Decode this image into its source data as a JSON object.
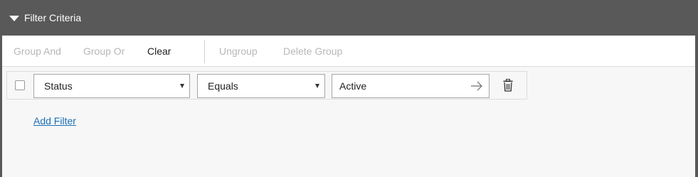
{
  "header": {
    "title": "Filter Criteria",
    "icon": "caret-down-icon"
  },
  "toolbar": {
    "group_and": "Group And",
    "group_or": "Group Or",
    "clear": "Clear",
    "ungroup": "Ungroup",
    "delete_group": "Delete Group"
  },
  "filter": {
    "field": "Status",
    "operator": "Equals",
    "value": "Active"
  },
  "add_filter_label": "Add Filter",
  "colors": {
    "header_bg": "#595959",
    "link": "#1a6fb8",
    "disabled_text": "#b7b7b7"
  }
}
